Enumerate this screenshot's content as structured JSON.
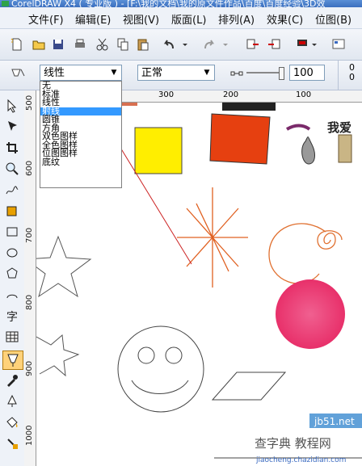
{
  "title": "CorelDRAW X4 ( 专业版 ) - [F:\\我的文档\\我的原文件作品\\百度\\百度经验\\3D效",
  "menu": [
    "文件(F)",
    "编辑(E)",
    "视图(V)",
    "版面(L)",
    "排列(A)",
    "效果(C)",
    "位图(B)"
  ],
  "property_bar": {
    "fill_type_value": "线性",
    "mode_value": "正常",
    "slider_value": "100",
    "right_values": [
      "0",
      "0"
    ]
  },
  "dropdown_options": [
    "无",
    "标准",
    "线性",
    "射线",
    "圆锥",
    "方角",
    "双色图样",
    "全色图样",
    "位图图样",
    "底纹"
  ],
  "dropdown_selected_index": 3,
  "hruler_labels": [
    "300",
    "200",
    "100"
  ],
  "vruler_labels": [
    "500",
    "600",
    "700",
    "800",
    "900",
    "1000"
  ],
  "canvas_text": "我爱",
  "watermark": {
    "line1": "jb51.net",
    "line2": "查字典 教程网",
    "line3": "jiaocheng.chazidian.com"
  },
  "colors": {
    "yellow_square": "#ffee00",
    "red_square": "#e64010",
    "radial_circle": "#e8306a",
    "spiral": "#e07030",
    "star_burst": "#e06020",
    "arrow_line": "#cc2222",
    "menu_bg": "#eef2f8"
  }
}
